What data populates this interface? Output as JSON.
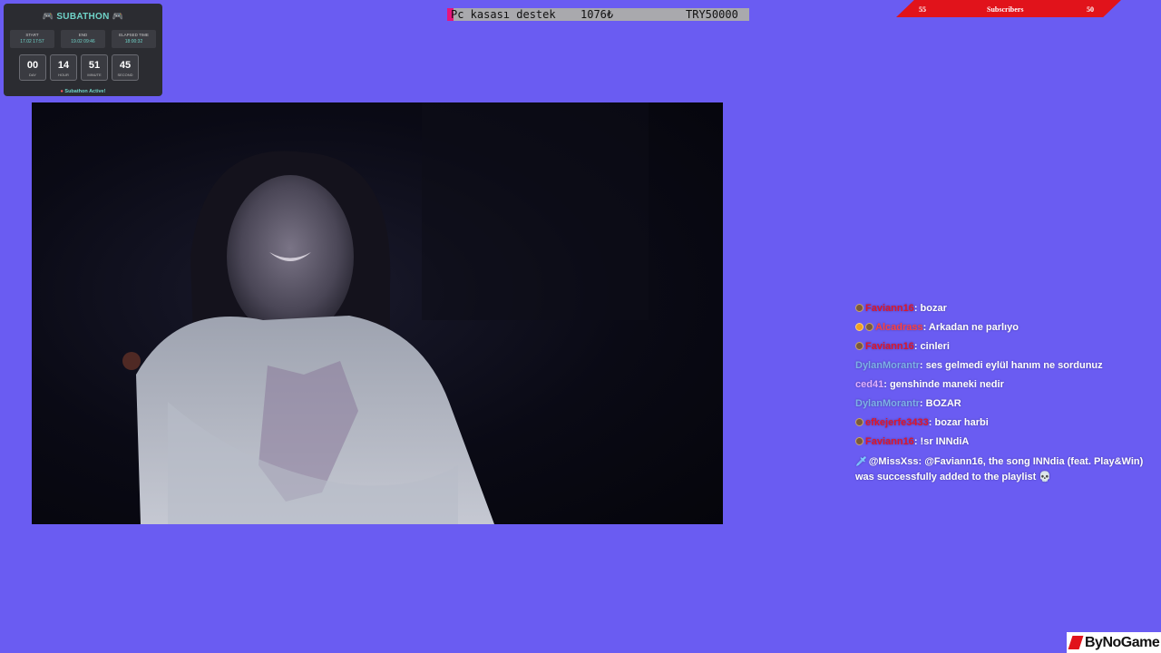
{
  "subathon": {
    "title": "SUBATHON",
    "boxes": [
      {
        "label": "START",
        "value": "17.02 17:57"
      },
      {
        "label": "END",
        "value": "19.02 09:46"
      },
      {
        "label": "ELAPSED TIME",
        "value": "18:00:32"
      }
    ],
    "timer": [
      {
        "value": "00",
        "unit": "DAY"
      },
      {
        "value": "14",
        "unit": "HOUR"
      },
      {
        "value": "51",
        "unit": "MINUTE"
      },
      {
        "value": "45",
        "unit": "SECOND"
      }
    ],
    "status": "Subathon Active!"
  },
  "donation": {
    "label": "Pc kasası destek",
    "amount": "1076₺",
    "goal": "TRY50000",
    "progress": 0.0215,
    "fill_color": "#e8147b"
  },
  "subscribers": {
    "left": "55",
    "label": "Subscribers",
    "right": "50"
  },
  "chat": [
    {
      "user": "Faviann16",
      "color": "#e0162b",
      "badges": [
        "sub"
      ],
      "text": "bozar"
    },
    {
      "user": "Alcadrass",
      "color": "#ff4040",
      "badges": [
        "gift",
        "sub"
      ],
      "text": "Arkadan ne parlıyo"
    },
    {
      "user": "Faviann16",
      "color": "#e0162b",
      "badges": [
        "sub"
      ],
      "text": "cinleri"
    },
    {
      "user": "DylanMorantr",
      "color": "#7db0e8",
      "badges": [],
      "text": "ses gelmedi eylül hanım ne sordunuz"
    },
    {
      "user": "ced41",
      "color": "#e0b0ff",
      "badges": [],
      "text": "genshinde maneki nedir"
    },
    {
      "user": "DylanMorantr",
      "color": "#7db0e8",
      "badges": [],
      "text": "BOZAR"
    },
    {
      "user": "efkejerfe3433",
      "color": "#e0162b",
      "badges": [
        "sub"
      ],
      "text": "bozar harbi"
    },
    {
      "user": "Faviann16",
      "color": "#e0162b",
      "badges": [
        "sub"
      ],
      "text": "!sr INNdiA"
    },
    {
      "user": "@MissXss",
      "color": "#ffffff",
      "badges": [
        "sword"
      ],
      "text": "@Faviann16, the song INNdia (feat. Play&Win) was successfully added to the playlist 💀"
    }
  ],
  "logo": {
    "text": "ByNoGame"
  },
  "colors": {
    "background": "#6a5cf2",
    "accent": "#6fd3c8",
    "brand_red": "#e1131b"
  }
}
